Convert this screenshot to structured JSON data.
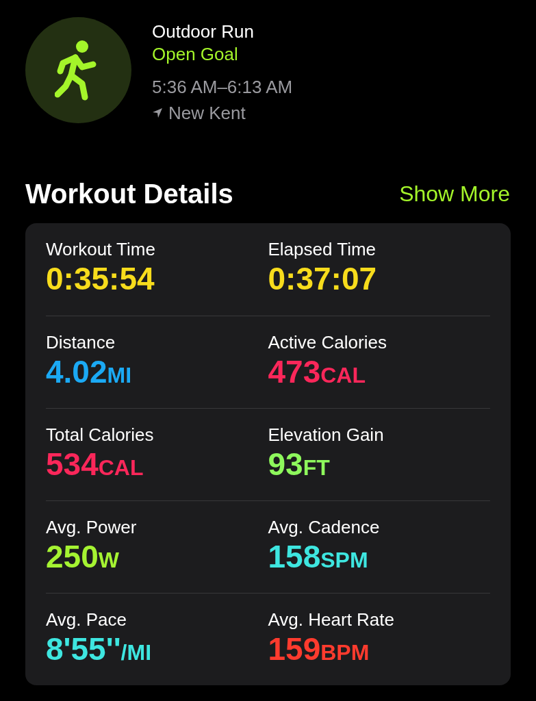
{
  "workout": {
    "title": "Outdoor Run",
    "goal": "Open Goal",
    "time": "5:36 AM–6:13 AM",
    "location": "New Kent"
  },
  "details": {
    "heading": "Workout Details",
    "action": "Show More",
    "metrics": [
      {
        "label": "Workout Time",
        "value": "0:35:54",
        "color": "#f7dc1c"
      },
      {
        "label": "Elapsed Time",
        "value": "0:37:07",
        "color": "#f7dc1c"
      },
      {
        "label": "Distance",
        "value": "4.02",
        "unit": "MI",
        "color": "#1ba9f4"
      },
      {
        "label": "Active Calories",
        "value": "473",
        "unit": "CAL",
        "color": "#fa275a"
      },
      {
        "label": "Total Calories",
        "value": "534",
        "unit": "CAL",
        "color": "#fa275a"
      },
      {
        "label": "Elevation Gain",
        "value": "93",
        "unit": "FT",
        "color": "#8ef85c"
      },
      {
        "label": "Avg. Power",
        "value": "250",
        "unit": "W",
        "color": "#a5f332"
      },
      {
        "label": "Avg. Cadence",
        "value": "158",
        "unit": "SPM",
        "color": "#3ee6e0"
      },
      {
        "label": "Avg. Pace",
        "value": "8'55''",
        "unit": "/MI",
        "color": "#3ee6e0"
      },
      {
        "label": "Avg. Heart Rate",
        "value": "159",
        "unit": "BPM",
        "color": "#ff3b2e"
      }
    ]
  }
}
